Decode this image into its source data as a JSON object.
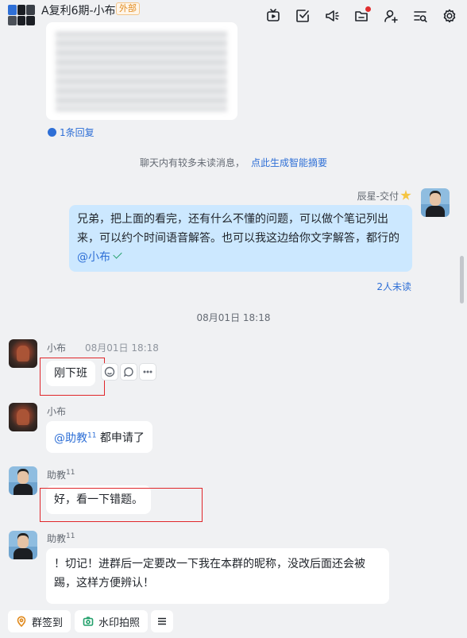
{
  "header": {
    "title": "A复利6期-小布",
    "badge": "外部",
    "toolbar_icons": [
      "video-icon",
      "task-check-icon",
      "announcement-icon",
      "folder-icon",
      "add-member-icon",
      "search-list-icon",
      "settings-icon"
    ]
  },
  "thread": {
    "reply_count": "1条回复"
  },
  "notice": {
    "text": "聊天内有较多未读消息，",
    "link": "点此生成智能摘要"
  },
  "messages": {
    "m1": {
      "sender": "辰星-交付",
      "text": "兄弟，把上面的看完，还有什么不懂的问题，可以做个笔记列出来，可以约个时间语音解答。也可以我这边给你文字解答，都行的",
      "mention": "@小布",
      "read_status": "2人未读"
    },
    "date_separator": "08月01日  18:18",
    "m2": {
      "sender": "小布",
      "time": "08月01日 18:18",
      "text": "刚下班"
    },
    "m3": {
      "sender": "小布",
      "mention": "@助教",
      "mention_sup": "11",
      "text": " 都申请了"
    },
    "m4": {
      "sender": "助教",
      "sender_sup": "11",
      "text": "好，看一下错题。"
    },
    "m5": {
      "sender": "助教",
      "sender_sup": "11",
      "text": "！切记！进群后一定要改一下我在本群的昵称，没改后面还会被踢，这样方便辨认！"
    }
  },
  "bottom": {
    "checkin": "群签到",
    "watermark_photo": "水印拍照"
  },
  "colors": {
    "link": "#2e6fd6",
    "my_bubble": "#cce8ff",
    "highlight_box": "#e0262a",
    "badge": "#e08a1e"
  }
}
